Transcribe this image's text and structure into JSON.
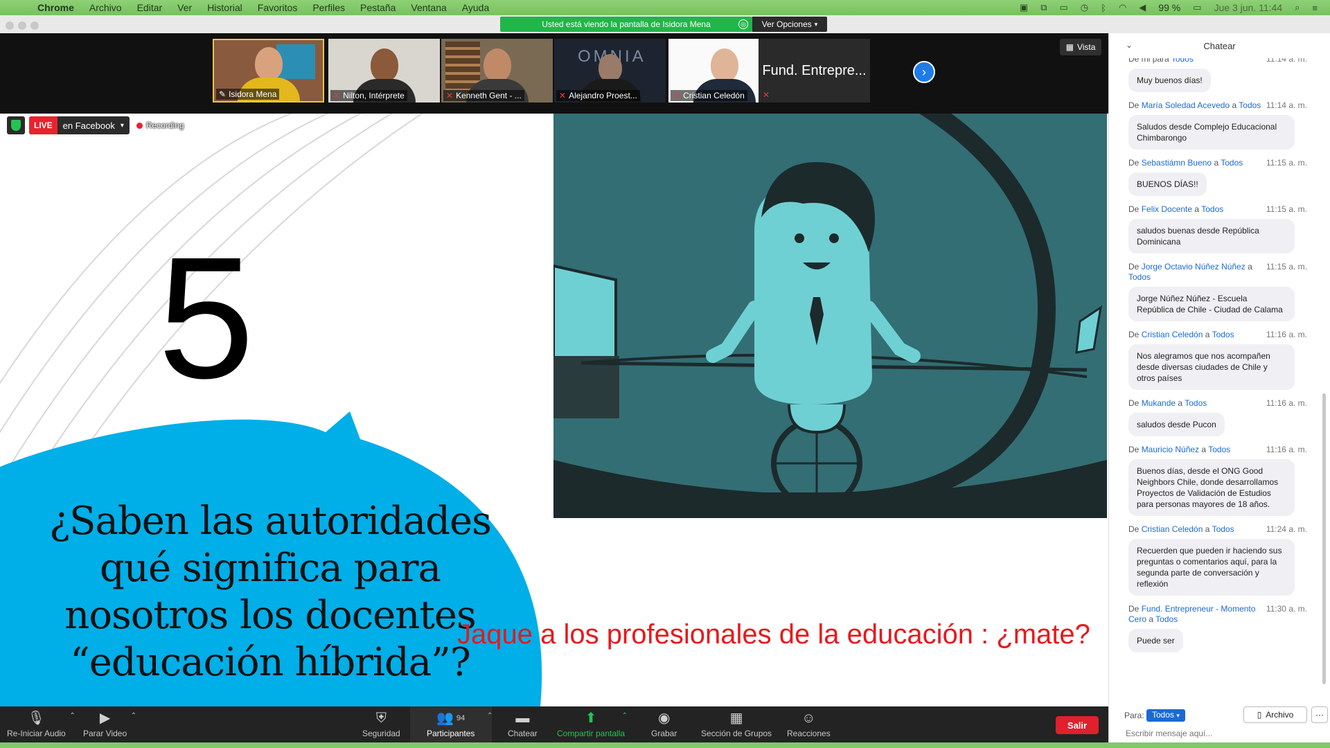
{
  "menubar": {
    "app": "Chrome",
    "items": [
      "Archivo",
      "Editar",
      "Ver",
      "Historial",
      "Favoritos",
      "Perfiles",
      "Pestaña",
      "Ventana",
      "Ayuda"
    ],
    "battery": "99 %",
    "datetime": "Jue 3 jun.  11:44"
  },
  "share_banner": {
    "text": "Usted está viendo la pantalla de Isidora Mena",
    "view_options": "Ver Opciones"
  },
  "gallery": {
    "participants": [
      {
        "name": "Isidora Mena",
        "active": true
      },
      {
        "name": "Nilton, Intérprete"
      },
      {
        "name": "Kenneth Gent - ..."
      },
      {
        "name": "Alejandro Proest..."
      },
      {
        "name": "Cristian Celedón"
      }
    ],
    "text_tile": "Fund. Entrepre...",
    "view_label": "Vista"
  },
  "live": {
    "tag": "LIVE",
    "destination": "en Facebook",
    "recording": "Recording"
  },
  "slide": {
    "number": "5",
    "question": "¿Saben las autoridades qué significa para nosotros los docentes “educación híbrida”?",
    "caption": "Jaque a los profesionales de la educación : ¿mate?"
  },
  "toolbar": {
    "audio": "Re-Iniciar Audio",
    "video": "Parar Video",
    "security": "Seguridad",
    "participants": "Participantes",
    "participants_count": "94",
    "chat": "Chatear",
    "share": "Compartir pantalla",
    "record": "Grabar",
    "breakout": "Sección de Grupos",
    "reactions": "Reacciones",
    "leave": "Salir"
  },
  "chat": {
    "title": "Chatear",
    "messages": [
      {
        "prefix": "De",
        "from": "mi",
        "mid": "para",
        "to": "Todos",
        "time": "11:14 a. m.",
        "text": "Muy buenos días!"
      },
      {
        "prefix": "De",
        "from": "María Soledad Acevedo",
        "mid": "a",
        "to": "Todos",
        "time": "11:14 a. m.",
        "text": "Saludos desde Complejo Educacional Chimbarongo"
      },
      {
        "prefix": "De",
        "from": "Sebastiámn Bueno",
        "mid": "a",
        "to": "Todos",
        "time": "11:15 a. m.",
        "text": "BUENOS DÍAS!!"
      },
      {
        "prefix": "De",
        "from": "Felix Docente",
        "mid": "a",
        "to": "Todos",
        "time": "11:15 a. m.",
        "text": "saludos buenas desde República Dominicana"
      },
      {
        "prefix": "De",
        "from": "Jorge Octavio Núñez Núñez",
        "mid": "a",
        "to": "Todos",
        "time": "11:15 a. m.",
        "text": "Jorge Núñez Núñez - Escuela República de Chile - Ciudad de Calama"
      },
      {
        "prefix": "De",
        "from": "Cristian Celedón",
        "mid": "a",
        "to": "Todos",
        "time": "11:16 a. m.",
        "text": "Nos alegramos que nos acompañen desde diversas ciudades de Chile y otros países"
      },
      {
        "prefix": "De",
        "from": "Mukande",
        "mid": "a",
        "to": "Todos",
        "time": "11:16 a. m.",
        "text": "saludos desde Pucon"
      },
      {
        "prefix": "De",
        "from": "Mauricio Núñez",
        "mid": "a",
        "to": "Todos",
        "time": "11:16 a. m.",
        "text": "Buenos días, desde el ONG Good Neighbors Chile, donde desarrollamos Proyectos de Validación de Estudios para personas mayores de 18 años."
      },
      {
        "prefix": "De",
        "from": "Cristian Celedón",
        "mid": "a",
        "to": "Todos",
        "time": "11:24 a. m.",
        "text": "Recuerden que pueden ir haciendo sus preguntas o comentarios aquí, para la segunda parte de conversación y reflexión"
      },
      {
        "prefix": "De",
        "from": "Fund. Entrepreneur - Momento Cero",
        "mid": "a",
        "to": "Todos",
        "time": "11:30 a. m.",
        "text": "Puede ser"
      }
    ],
    "to_label": "Para:",
    "to_value": "Todos",
    "file_button": "Archivo",
    "more_button": "···",
    "input_placeholder": "Escribir mensaje aquí..."
  },
  "colors": {
    "zoom_green": "#23c552",
    "zoom_blue": "#1a6ad6",
    "live_red": "#e8232d",
    "slide_teal": "#336e74",
    "bubble_blue": "#00aee8",
    "caption_red": "#e8181c"
  }
}
